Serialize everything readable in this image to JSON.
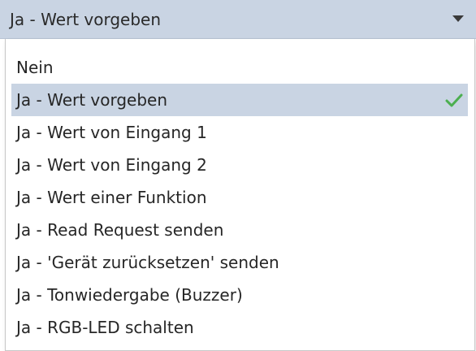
{
  "select": {
    "value": "Ja - Wert vorgeben",
    "arrow_icon": "caret-down-icon"
  },
  "options": [
    {
      "label": "Nein",
      "selected": false
    },
    {
      "label": "Ja - Wert vorgeben",
      "selected": true
    },
    {
      "label": "Ja - Wert von Eingang 1",
      "selected": false
    },
    {
      "label": "Ja - Wert von Eingang 2",
      "selected": false
    },
    {
      "label": "Ja - Wert einer Funktion",
      "selected": false
    },
    {
      "label": "Ja - Read Request senden",
      "selected": false
    },
    {
      "label": "Ja - 'Gerät zurücksetzen' senden",
      "selected": false
    },
    {
      "label": "Ja - Tonwiedergabe (Buzzer)",
      "selected": false
    },
    {
      "label": "Ja - RGB-LED schalten",
      "selected": false
    }
  ],
  "colors": {
    "selection_background": "#c9d4e3",
    "check_color": "#4caf50",
    "text": "#262626"
  },
  "icons": {
    "selected_marker": "check-icon"
  }
}
